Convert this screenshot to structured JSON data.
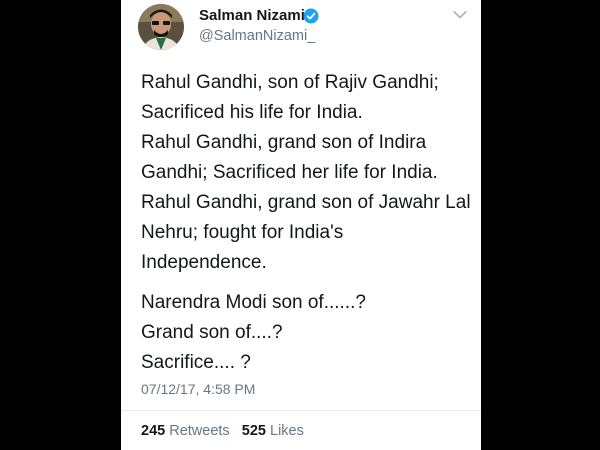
{
  "user": {
    "name": "Salman Nizami",
    "handle": "@SalmanNizami_",
    "verified_color": "#1da1f2"
  },
  "tweet": {
    "paragraphs": [
      [
        "Rahul Gandhi, son of Rajiv Gandhi;",
        "Sacrificed his life for India.",
        "Rahul Gandhi, grand son of Indira",
        "Gandhi; Sacrificed her life for India.",
        "Rahul Gandhi, grand son of Jawahr Lal",
        "Nehru; fought for India's",
        "Independence."
      ],
      [
        "Narendra Modi son of......?",
        "Grand son of....?",
        "Sacrifice.... ?"
      ]
    ],
    "timestamp": "07/12/17, 4:58 PM"
  },
  "stats": {
    "retweets_count": "245",
    "retweets_label": "Retweets",
    "likes_count": "525",
    "likes_label": "Likes"
  }
}
